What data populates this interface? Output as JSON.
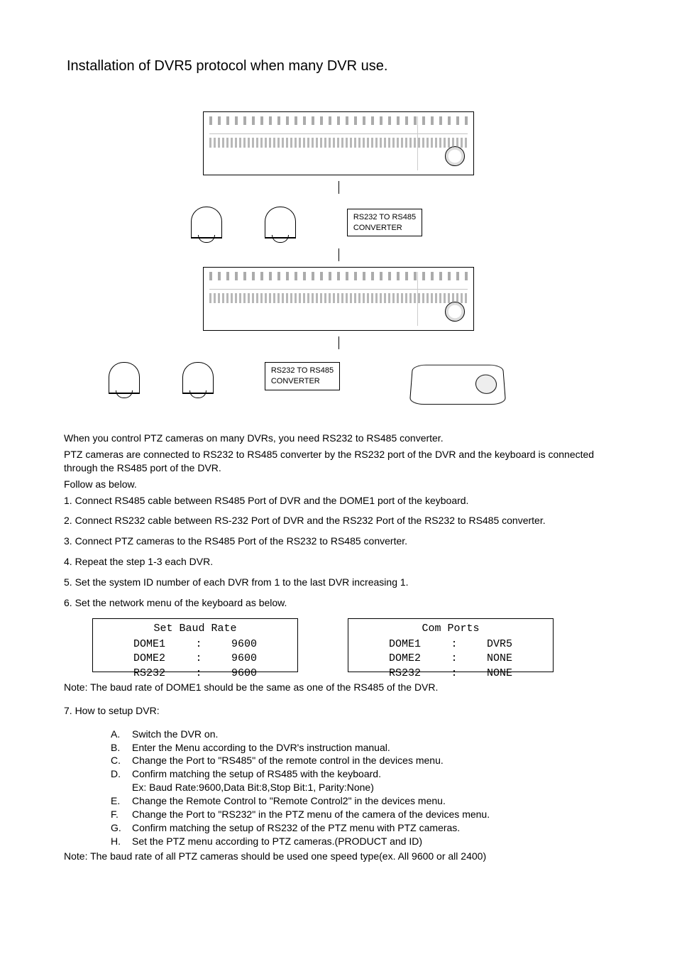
{
  "title": "Installation of DVR5 protocol when many DVR use.",
  "diagram": {
    "converter_label_line1": "RS232 TO RS485",
    "converter_label_line2": "CONVERTER"
  },
  "intro": {
    "line1": "When you control PTZ cameras on many DVRs, you need RS232 to RS485 converter.",
    "line2": "PTZ cameras are connected to RS232 to RS485 converter by the RS232 port of the DVR and the keyboard is connected through the RS485 port of the DVR.",
    "line3": "Follow as below."
  },
  "steps": {
    "s1": "1.  Connect RS485 cable between RS485 Port of DVR and the DOME1 port of the keyboard.",
    "s2": "2.  Connect RS232 cable between RS-232 Port of DVR and the RS232 Port of the RS232 to RS485 converter.",
    "s3": "3.  Connect PTZ cameras to the RS485 Port of the RS232 to RS485 converter.",
    "s4": "4.  Repeat the step 1-3 each DVR.",
    "s5": "5.  Set the system ID number of each DVR from 1 to the last DVR increasing 1.",
    "s6": "6.  Set the network menu of the keyboard as below."
  },
  "lcd_baud": {
    "title": "Set Baud Rate",
    "rows": [
      {
        "name": "DOME1",
        "sep": ":",
        "val": "9600"
      },
      {
        "name": "DOME2",
        "sep": ":",
        "val": "9600"
      },
      {
        "name": "RS232",
        "sep": ":",
        "val": "9600"
      }
    ]
  },
  "lcd_com": {
    "title": "Com Ports",
    "rows": [
      {
        "name": "DOME1",
        "sep": ":",
        "val": "DVR5"
      },
      {
        "name": "DOME2",
        "sep": ":",
        "val": "NONE"
      },
      {
        "name": "RS232",
        "sep": ":",
        "val": "NONE"
      }
    ]
  },
  "note1": "Note: The baud rate of DOME1 should be the same as one of the RS485 of the DVR.",
  "step7_label": "7.  How to setup DVR:",
  "substeps": {
    "A": "Switch the DVR on.",
    "B": "Enter the Menu according to the DVR's instruction manual.",
    "C": "Change the Port to \"RS485\" of the remote control in the devices menu.",
    "D": "Confirm matching the setup of RS485 with the keyboard.",
    "D_ex": "Ex: Baud Rate:9600,Data Bit:8,Stop Bit:1, Parity:None)",
    "E": "Change the Remote Control to \"Remote Control2\" in the devices menu.",
    "F": "Change the Port to \"RS232\" in the PTZ menu of the camera of the devices menu.",
    "G": "Confirm matching the setup of RS232 of the PTZ menu with PTZ cameras.",
    "H": "Set the PTZ menu according to PTZ cameras.(PRODUCT and ID)"
  },
  "note2": "Note: The baud rate of all PTZ cameras should be used one speed type(ex. All 9600 or all 2400)"
}
